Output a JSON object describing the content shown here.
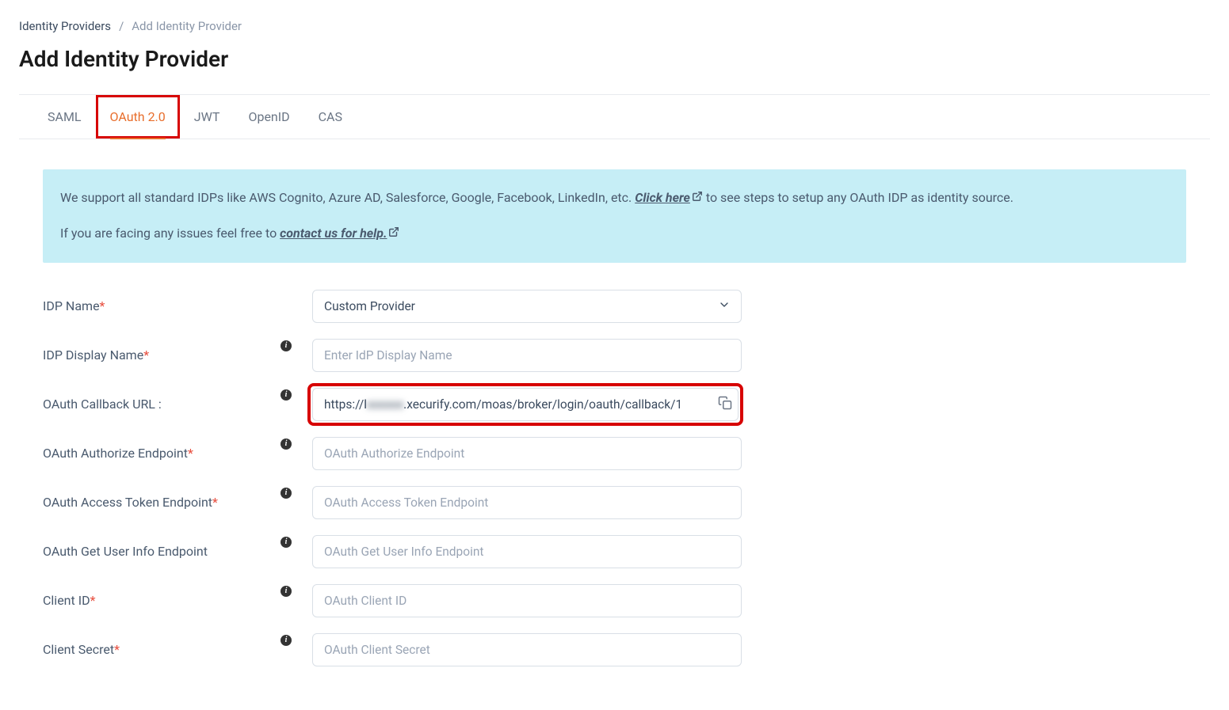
{
  "breadcrumb": {
    "root": "Identity Providers",
    "separator": "/",
    "current": "Add Identity Provider"
  },
  "page": {
    "title": "Add Identity Provider"
  },
  "tabs": {
    "items": [
      {
        "label": "SAML",
        "active": false
      },
      {
        "label": "OAuth 2.0",
        "active": true
      },
      {
        "label": "JWT",
        "active": false
      },
      {
        "label": "OpenID",
        "active": false
      },
      {
        "label": "CAS",
        "active": false
      }
    ]
  },
  "info_box": {
    "line1_prefix": "We support all standard IDPs like AWS Cognito, Azure AD, Salesforce, Google, Facebook, LinkedIn, etc. ",
    "line1_link": "Click here",
    "line1_suffix": " to see steps to setup any OAuth IDP as identity source.",
    "line2_prefix": "If you are facing any issues feel free to ",
    "line2_link": "contact us for help."
  },
  "form": {
    "idp_name": {
      "label": "IDP Name",
      "value": "Custom Provider"
    },
    "idp_display_name": {
      "label": "IDP Display Name",
      "placeholder": "Enter IdP Display Name"
    },
    "callback_url": {
      "label": "OAuth Callback URL :",
      "value_prefix": "https://l",
      "value_blurred": "xxxxxx",
      "value_suffix": ".xecurify.com/moas/broker/login/oauth/callback/1"
    },
    "authorize_endpoint": {
      "label": "OAuth Authorize Endpoint",
      "placeholder": "OAuth Authorize Endpoint"
    },
    "access_token_endpoint": {
      "label": "OAuth Access Token Endpoint",
      "placeholder": "OAuth Access Token Endpoint"
    },
    "user_info_endpoint": {
      "label": "OAuth Get User Info Endpoint",
      "placeholder": "OAuth Get User Info Endpoint"
    },
    "client_id": {
      "label": "Client ID",
      "placeholder": "OAuth Client ID"
    },
    "client_secret": {
      "label": "Client Secret",
      "placeholder": "OAuth Client Secret"
    }
  }
}
